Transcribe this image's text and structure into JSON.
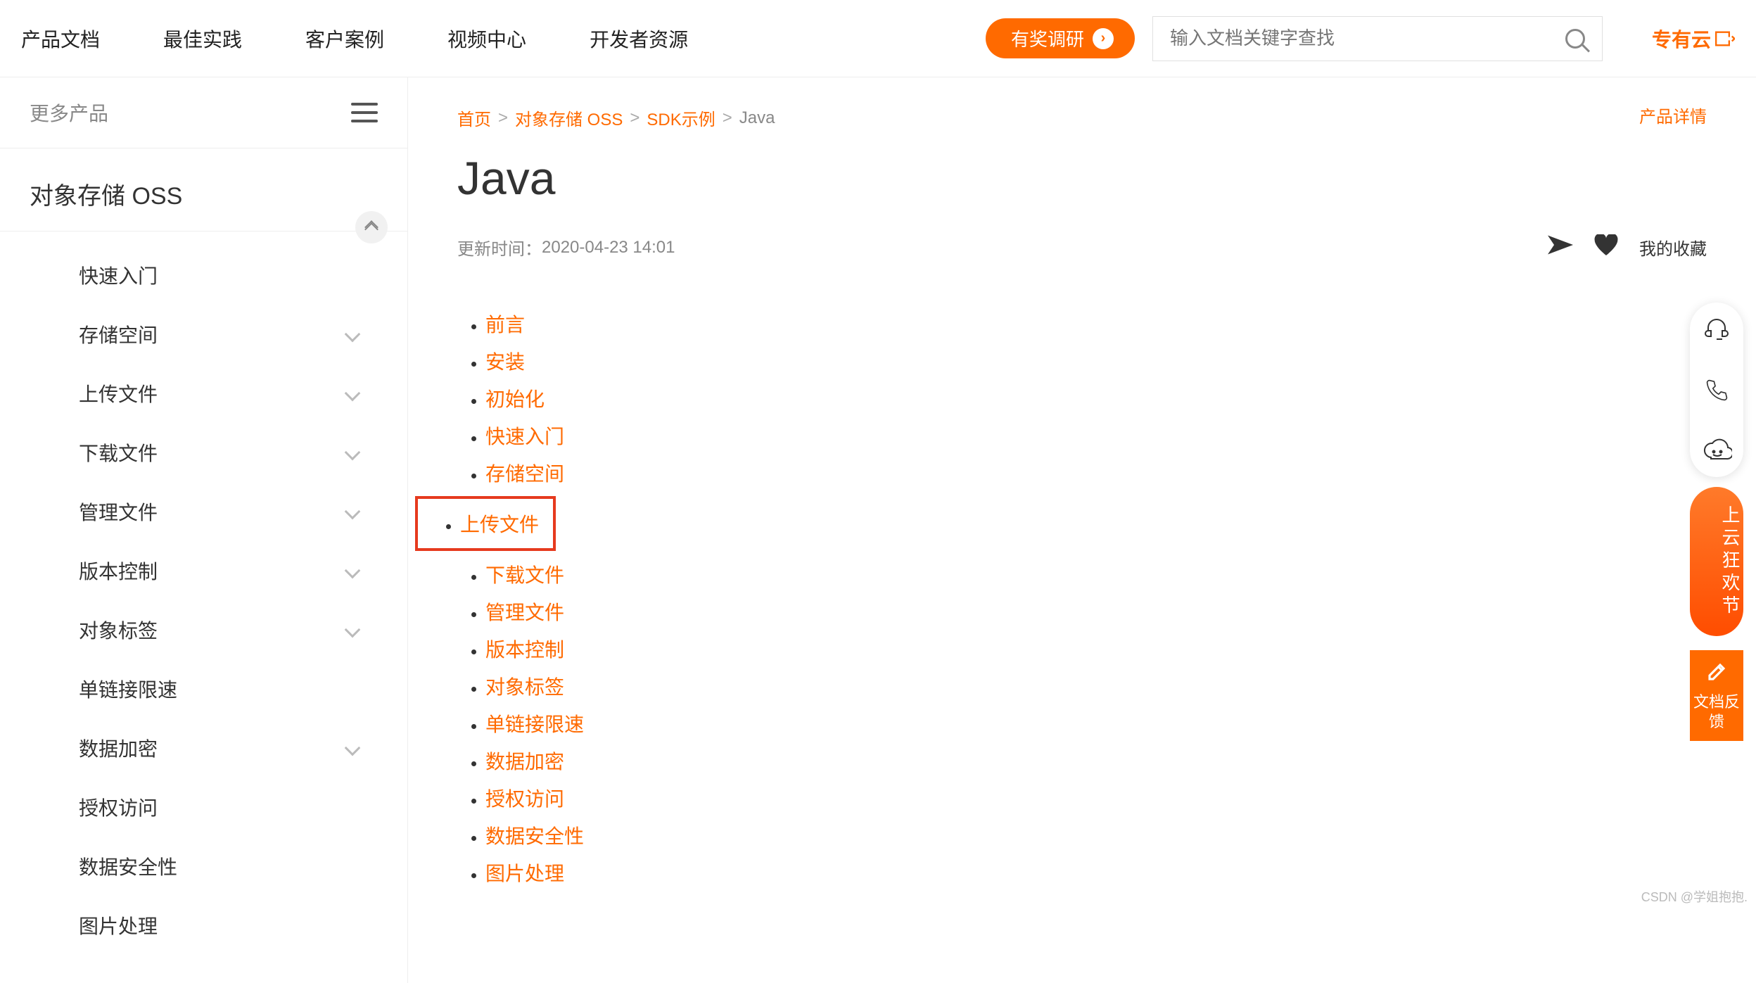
{
  "topnav": {
    "links": [
      "产品文档",
      "最佳实践",
      "客户案例",
      "视频中心",
      "开发者资源"
    ],
    "survey_btn": "有奖调研",
    "search_placeholder": "输入文档关键字查找",
    "private_cloud": "专有云"
  },
  "sidebar": {
    "more_label": "更多产品",
    "product_title": "对象存储 OSS",
    "items": [
      {
        "label": "快速入门",
        "expandable": false
      },
      {
        "label": "存储空间",
        "expandable": true
      },
      {
        "label": "上传文件",
        "expandable": true
      },
      {
        "label": "下载文件",
        "expandable": true
      },
      {
        "label": "管理文件",
        "expandable": true
      },
      {
        "label": "版本控制",
        "expandable": true
      },
      {
        "label": "对象标签",
        "expandable": true
      },
      {
        "label": "单链接限速",
        "expandable": false
      },
      {
        "label": "数据加密",
        "expandable": true
      },
      {
        "label": "授权访问",
        "expandable": false
      },
      {
        "label": "数据安全性",
        "expandable": false
      },
      {
        "label": "图片处理",
        "expandable": false
      }
    ]
  },
  "breadcrumb": {
    "items": [
      {
        "label": "首页",
        "link": true
      },
      {
        "label": "对象存储 OSS",
        "link": true
      },
      {
        "label": "SDK示例",
        "link": true
      },
      {
        "label": "Java",
        "link": false
      }
    ],
    "product_detail": "产品详情"
  },
  "page": {
    "title": "Java",
    "updated_label": "更新时间：",
    "updated_value": "2020-04-23 14:01",
    "favorites_label": "我的收藏"
  },
  "toc": [
    "前言",
    "安装",
    "初始化",
    "快速入门",
    "存储空间",
    "上传文件",
    "下载文件",
    "管理文件",
    "版本控制",
    "对象标签",
    "单链接限速",
    "数据加密",
    "授权访问",
    "数据安全性",
    "图片处理"
  ],
  "toc_highlight_index": 5,
  "float_rail": {
    "red_pill": "上云狂欢节",
    "feedback": "文档反馈"
  },
  "watermark": "CSDN @学姐抱抱."
}
